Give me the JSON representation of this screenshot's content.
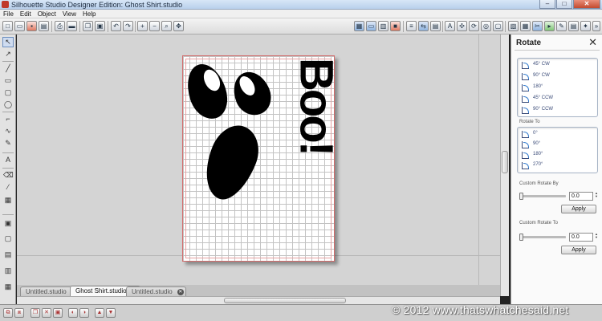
{
  "window": {
    "title": "Silhouette Studio Designer Edition: Ghost Shirt.studio",
    "minimize": "–",
    "maximize": "□",
    "close": "✕"
  },
  "menu": [
    "File",
    "Edit",
    "Object",
    "View",
    "Help"
  ],
  "toolbar_icons": [
    "new-icon",
    "open-icon",
    "save-icon",
    "print-icon",
    "copy-icon",
    "paste-icon",
    "undo-icon",
    "redo-icon",
    "zoom-in-icon",
    "zoom-out-icon",
    "zoom-fit-icon",
    "pan-icon"
  ],
  "canvas": {
    "design_text": "Boo!"
  },
  "tabs": [
    {
      "label": "Untitled.studio",
      "active": false
    },
    {
      "label": "Ghost Shirt.studio",
      "active": true
    },
    {
      "label": "Untitled.studio",
      "active": false
    }
  ],
  "panel": {
    "title": "Rotate",
    "rotate_presets": [
      "45° CW",
      "90° CW",
      "180°",
      "45° CCW",
      "90° CCW"
    ],
    "rotate_to_label": "Rotate To",
    "rotate_to_presets": [
      "0°",
      "90°",
      "180°",
      "270°"
    ],
    "custom_rotate_by_label": "Custom Rotate By",
    "custom_rotate_by_value": "0.0",
    "custom_rotate_to_label": "Custom Rotate To",
    "custom_rotate_to_value": "0.0",
    "apply_label": "Apply"
  },
  "watermark": "© 2012 www.thatswhatchesaid.net"
}
